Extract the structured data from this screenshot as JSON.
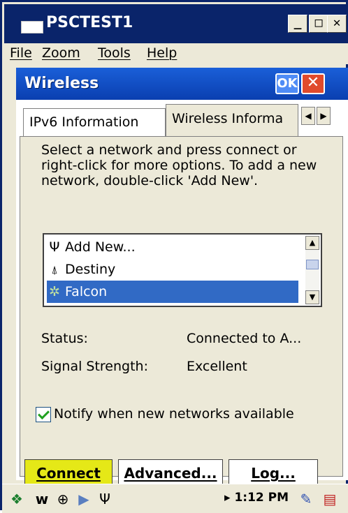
{
  "window": {
    "title": "PSCTEST1",
    "minimize_label": "_",
    "maximize_label": "□",
    "close_label": "✕"
  },
  "menu": {
    "items": [
      "File",
      "Zoom",
      "Tools",
      "Help"
    ]
  },
  "dialog": {
    "title": "Wireless",
    "ok_label": "OK",
    "close_label": "✕",
    "tabs": [
      {
        "label": "IPv6 Information",
        "active": false
      },
      {
        "label": "Wireless Informa",
        "active": true
      }
    ],
    "tab_scroll_left": "◀",
    "tab_scroll_right": "▶",
    "instructions": "Select a network and press connect or right-click for more options.  To add a new network, double-click 'Add New'.",
    "networks": [
      {
        "label": "Add New...",
        "icon": "antenna-icon",
        "glyph": "Ψ",
        "selected": false
      },
      {
        "label": "Destiny",
        "icon": "access-point-icon",
        "glyph": "⍋",
        "selected": false
      },
      {
        "label": "Falcon",
        "icon": "connected-network-icon",
        "glyph": "✲",
        "selected": true
      }
    ],
    "status_label": "Status:",
    "status_value": "Connected to A...",
    "signal_label": "Signal Strength:",
    "signal_value": "Excellent",
    "notify_label": "Notify when new networks available",
    "notify_checked": true,
    "buttons": {
      "connect": "Connect",
      "advanced": "Advanced...",
      "log": "Log..."
    }
  },
  "taskbar": {
    "clock": "1:12 PM",
    "start_glyph": "❖",
    "w_glyph": "w",
    "colors": {
      "start": "#1b7f2e",
      "connect_button": "#e5e817",
      "selection": "#316ac5"
    }
  }
}
